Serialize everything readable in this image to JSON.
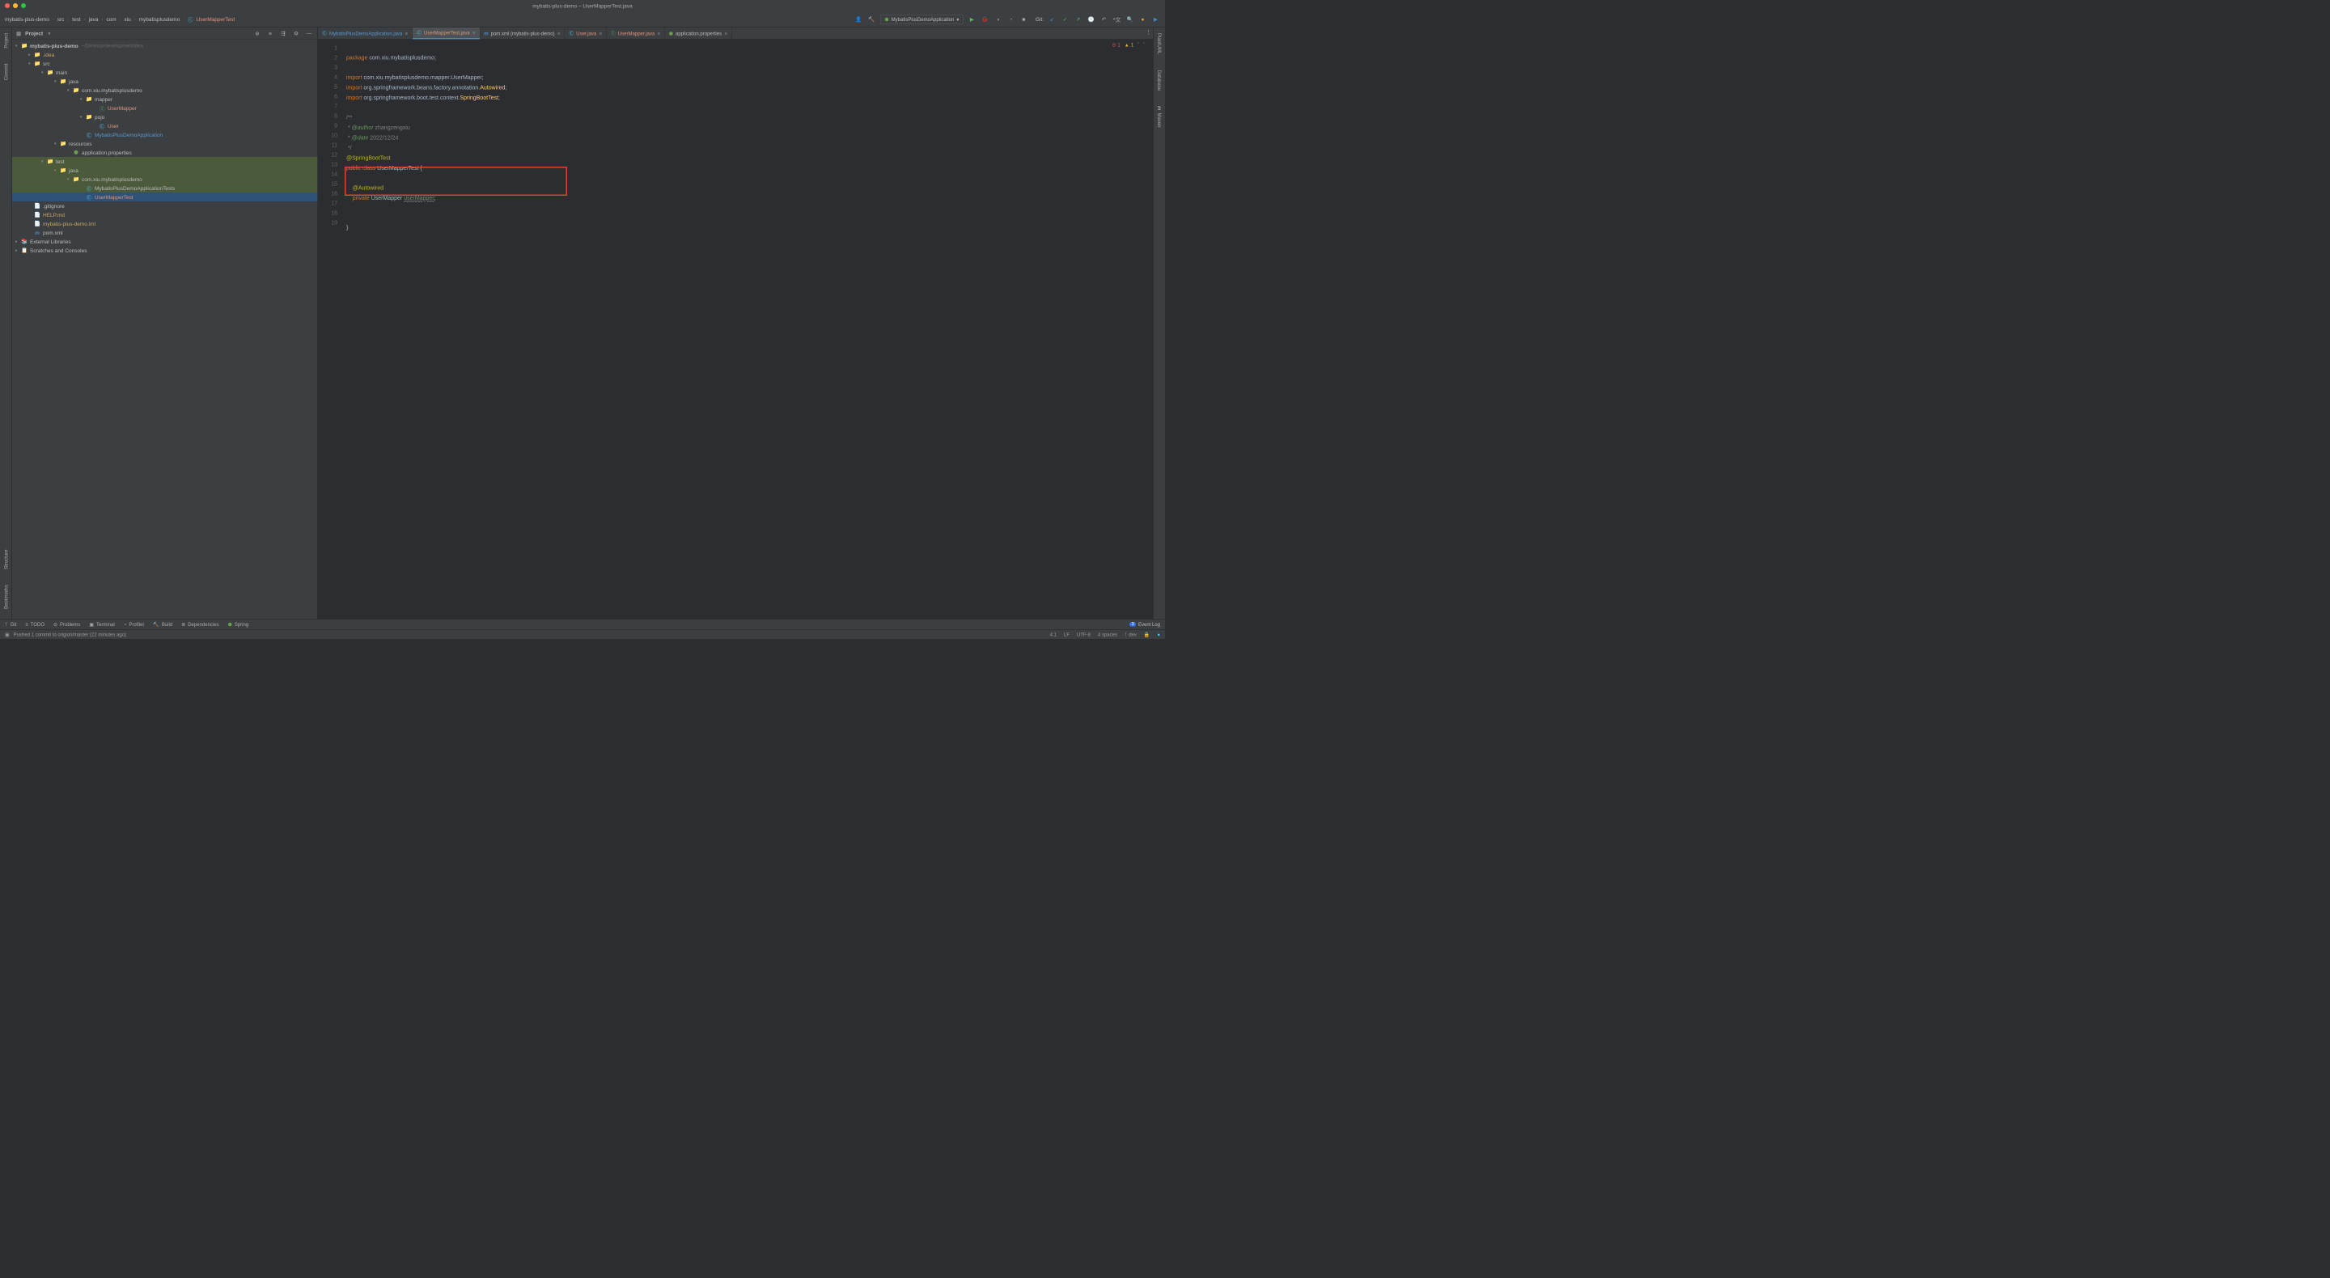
{
  "window": {
    "title": "mybatis-plus-demo – UserMapperTest.java"
  },
  "breadcrumb": [
    "mybatis-plus-demo",
    "src",
    "test",
    "java",
    "com",
    "xiu",
    "mybatisplusdemo",
    "UserMapperTest"
  ],
  "runConfig": {
    "label": "MybatisPlusDemoApplication"
  },
  "git": {
    "label": "Git:"
  },
  "projectPanel": {
    "title": "Project"
  },
  "tree": {
    "root": {
      "label": "mybatis-plus-demo",
      "hint": "~/Desktop/development/idea"
    },
    "idea": ".idea",
    "src": "src",
    "main": "main",
    "java": "java",
    "pkg": "com.xiu.mybatisplusdemo",
    "mapper": "mapper",
    "userMapper": "UserMapper",
    "pojo": "pojo",
    "user": "User",
    "app": "MybatisPlusDemoApplication",
    "resources": "resources",
    "appProps": "application.properties",
    "test": "test",
    "testJava": "java",
    "testPkg": "com.xiu.mybatisplusdemo",
    "tests": "MybatisPlusDemoApplicationTests",
    "userMapperTest": "UserMapperTest",
    "gitignore": ".gitignore",
    "help": "HELP.md",
    "iml": "mybatis-plus-demo.iml",
    "pom": "pom.xml",
    "extLib": "External Libraries",
    "scratches": "Scratches and Consoles"
  },
  "tabs": [
    {
      "label": "MybatisPlusDemoApplication.java",
      "color": "blue"
    },
    {
      "label": "UserMapperTest.java",
      "color": "coral",
      "active": true
    },
    {
      "label": "pom.xml (mybatis-plus-demo)",
      "color": ""
    },
    {
      "label": "User.java",
      "color": "coral"
    },
    {
      "label": "UserMapper.java",
      "color": "coral"
    },
    {
      "label": "application.properties",
      "color": ""
    }
  ],
  "code": {
    "lines": [
      1,
      2,
      3,
      4,
      5,
      6,
      7,
      8,
      9,
      10,
      11,
      12,
      13,
      14,
      15,
      16,
      17,
      18,
      19
    ],
    "l1": {
      "kw": "package",
      "pkg": " com.xiu.mybatisplusdemo",
      ";": ";"
    },
    "l3": {
      "kw": "import",
      "pkg": " com.xiu.mybatisplusdemo.mapper.UserMapper;"
    },
    "l4": {
      "kw": "import",
      "pkg": " org.springframework.beans.factory.annotation.",
      "cls": "Autowired",
      ";": ";"
    },
    "l5": {
      "kw": "import",
      "pkg": " org.springframework.boot.test.context.",
      "cls": "SpringBootTest",
      ";": ";"
    },
    "l7": "/**",
    "l8": {
      "star": " * ",
      "tag": "@author",
      "name": " zhangzengxiu"
    },
    "l9": {
      "star": " * ",
      "tag": "@date",
      "val": " 2022/12/24"
    },
    "l10": " */",
    "l11": "@SpringBootTest",
    "l12": {
      "kw1": "public ",
      "kw2": "class ",
      "cls": "UserMapperTest ",
      "b": "{"
    },
    "l14": "    @Autowired",
    "l15": {
      "kw": "    private ",
      "cls": "UserMapper ",
      "var": "userMapper",
      ";": ";"
    },
    "l18": "}"
  },
  "indicators": {
    "errors": "1",
    "warnings": "1"
  },
  "bottomToolbar": {
    "git": "Git",
    "todo": "TODO",
    "problems": "Problems",
    "terminal": "Terminal",
    "profiler": "Profiler",
    "build": "Build",
    "dependencies": "Dependencies",
    "spring": "Spring",
    "eventLog": "Event Log",
    "eventCount": "3"
  },
  "statusBar": {
    "msg": "Pushed 1 commit to origion/master (22 minutes ago)",
    "pos": "4:1",
    "lf": "LF",
    "enc": "UTF-8",
    "indent": "4 spaces",
    "branch": "dev"
  },
  "sideTabs": {
    "project": "Project",
    "commit": "Commit",
    "structure": "Structure",
    "bookmarks": "Bookmarks",
    "plantuml": "PlantUML",
    "database": "Database",
    "maven": "Maven"
  }
}
